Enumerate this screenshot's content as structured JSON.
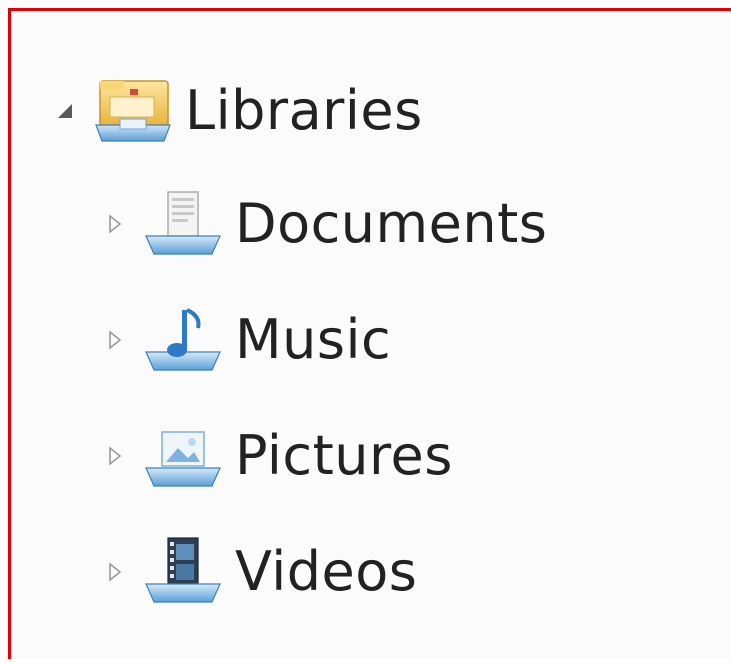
{
  "tree": {
    "root": {
      "label": "Libraries",
      "icon": "libraries-folder-icon",
      "expander": "expanded-triangle",
      "expanded": true
    },
    "items": [
      {
        "label": "Documents",
        "icon": "documents-library-icon",
        "expander": "collapsed-triangle"
      },
      {
        "label": "Music",
        "icon": "music-library-icon",
        "expander": "collapsed-triangle"
      },
      {
        "label": "Pictures",
        "icon": "pictures-library-icon",
        "expander": "collapsed-triangle"
      },
      {
        "label": "Videos",
        "icon": "videos-library-icon",
        "expander": "collapsed-triangle"
      }
    ]
  },
  "colors": {
    "highlight_border": "#e00000",
    "text": "#222222",
    "pane_background": "#fbfbfb",
    "library_blue": "#5a9fd8",
    "folder_yellow": "#f3c64c"
  }
}
